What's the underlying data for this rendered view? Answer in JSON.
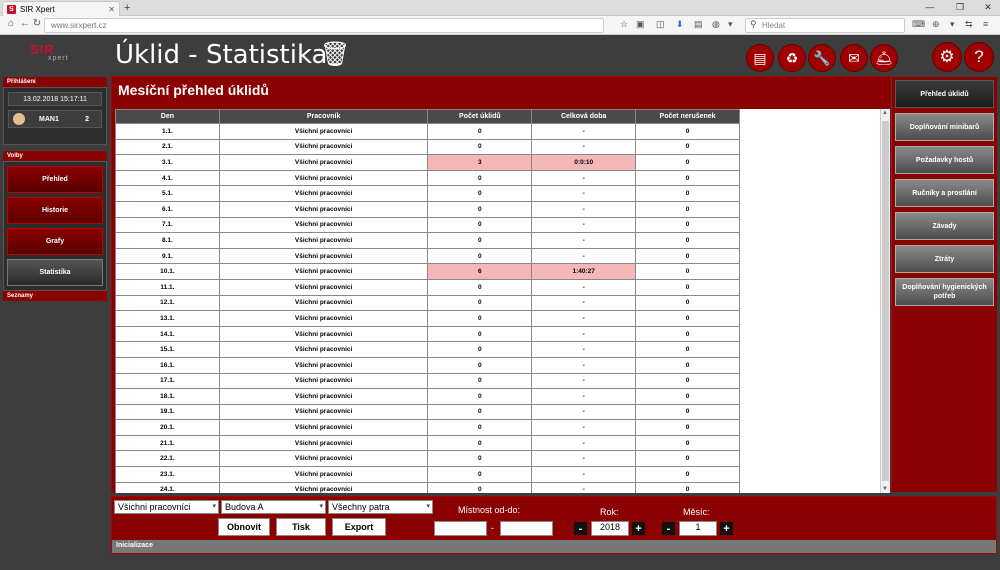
{
  "browser": {
    "tab_title": "SIR Xpert",
    "favicon": "S",
    "url": "www.sirxpert.cz",
    "search_placeholder": "Hledat"
  },
  "app": {
    "logo_top": "SIR",
    "logo_sub": "xpert",
    "title": "Úklid - Statistika"
  },
  "login": {
    "header": "Přihlášení",
    "datetime": "13.02.2018 15:17:11",
    "user": "MAN1",
    "count": "2"
  },
  "menu": {
    "header": "Volby",
    "items": [
      "Přehled",
      "Historie",
      "Grafy",
      "Statistika"
    ],
    "footer": "Seznamy"
  },
  "main": {
    "title": "Mesíční přehled úklidů"
  },
  "table": {
    "columns": [
      "Den",
      "Pracovník",
      "Počet úklidů",
      "Celková doba",
      "Počet nerušenek"
    ],
    "rows": [
      [
        "1.1.",
        "Všichni pracovníci",
        "0",
        "-",
        "0"
      ],
      [
        "2.1.",
        "Všichni pracovníci",
        "0",
        "-",
        "0"
      ],
      [
        "3.1.",
        "Všichni pracovníci",
        "3",
        "0:0:10",
        "0"
      ],
      [
        "4.1.",
        "Všichni pracovníci",
        "0",
        "-",
        "0"
      ],
      [
        "5.1.",
        "Všichni pracovníci",
        "0",
        "-",
        "0"
      ],
      [
        "6.1.",
        "Všichni pracovníci",
        "0",
        "-",
        "0"
      ],
      [
        "7.1.",
        "Všichni pracovníci",
        "0",
        "-",
        "0"
      ],
      [
        "8.1.",
        "Všichni pracovníci",
        "0",
        "-",
        "0"
      ],
      [
        "9.1.",
        "Všichni pracovníci",
        "0",
        "-",
        "0"
      ],
      [
        "10.1.",
        "Všichni pracovníci",
        "6",
        "1:40:27",
        "0"
      ],
      [
        "11.1.",
        "Všichni pracovníci",
        "0",
        "-",
        "0"
      ],
      [
        "12.1.",
        "Všichni pracovníci",
        "0",
        "-",
        "0"
      ],
      [
        "13.1.",
        "Všichni pracovníci",
        "0",
        "-",
        "0"
      ],
      [
        "14.1.",
        "Všichni pracovníci",
        "0",
        "-",
        "0"
      ],
      [
        "15.1.",
        "Všichni pracovníci",
        "0",
        "-",
        "0"
      ],
      [
        "16.1.",
        "Všichni pracovníci",
        "0",
        "-",
        "0"
      ],
      [
        "17.1.",
        "Všichni pracovníci",
        "0",
        "-",
        "0"
      ],
      [
        "18.1.",
        "Všichni pracovníci",
        "0",
        "-",
        "0"
      ],
      [
        "19.1.",
        "Všichni pracovníci",
        "0",
        "-",
        "0"
      ],
      [
        "20.1.",
        "Všichni pracovníci",
        "0",
        "-",
        "0"
      ],
      [
        "21.1.",
        "Všichni pracovníci",
        "0",
        "-",
        "0"
      ],
      [
        "22.1.",
        "Všichni pracovníci",
        "0",
        "-",
        "0"
      ],
      [
        "23.1.",
        "Všichni pracovníci",
        "0",
        "-",
        "0"
      ],
      [
        "24.1.",
        "Všichni pracovníci",
        "0",
        "-",
        "0"
      ]
    ],
    "highlight_rows": [
      2,
      9
    ],
    "highlight_color": "#f4b8b8"
  },
  "right_menu": {
    "items": [
      "Přehled úklidů",
      "Doplňování minibarů",
      "Požadavky hostů",
      "Ručníky a prostlání",
      "Závady",
      "Ztráty",
      "Doplňování hygienických potřeb"
    ]
  },
  "filters": {
    "worker": "Všichni pracovníci",
    "building": "Budova A",
    "floor": "Všechny patra",
    "refresh_label": "Obnovit",
    "print_label": "Tisk",
    "export_label": "Export",
    "room_label": "Místnost od-do:",
    "room_sep": "-",
    "room_from": "",
    "room_to": "",
    "year_label": "Rok:",
    "year": "2018",
    "month_label": "Měsíc:",
    "month": "1",
    "minus": "-",
    "plus": "+"
  },
  "status": "Inicializace",
  "colors": {
    "accent": "#8b0000",
    "background": "#3d3d3d"
  }
}
